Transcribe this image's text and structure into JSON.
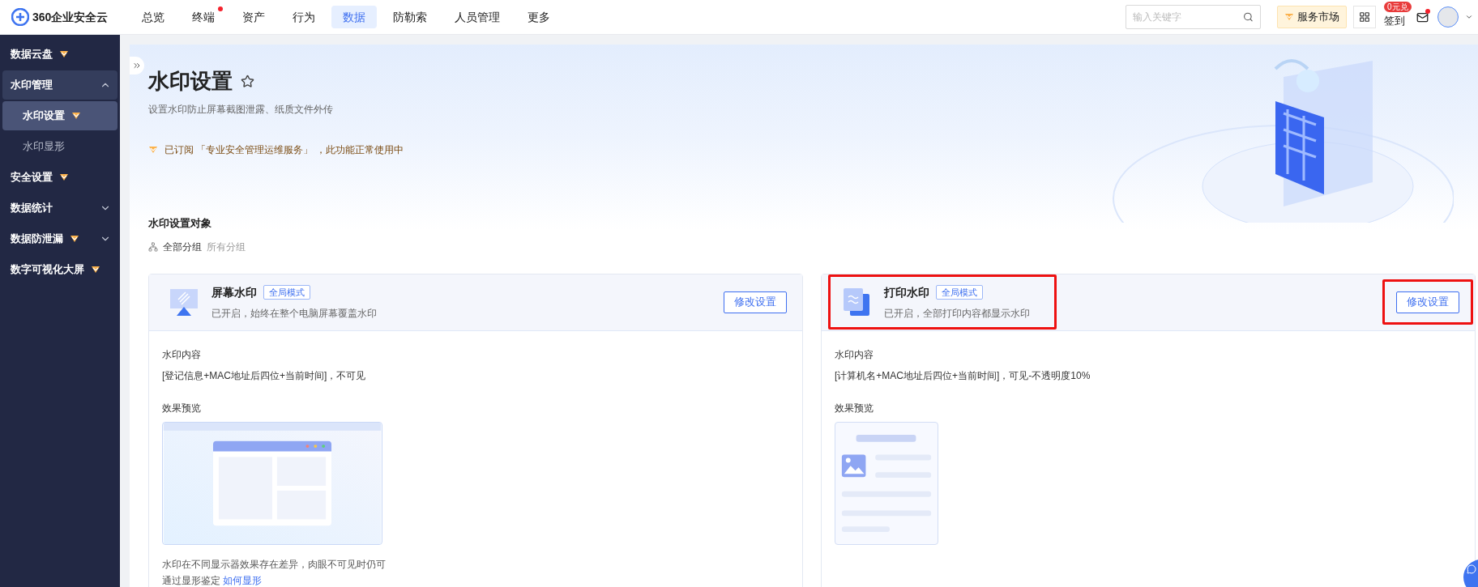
{
  "brand": "360企业安全云",
  "nav": [
    {
      "label": "总览",
      "selected": false,
      "alert": false
    },
    {
      "label": "终端",
      "selected": false,
      "alert": true
    },
    {
      "label": "资产",
      "selected": false,
      "alert": false
    },
    {
      "label": "行为",
      "selected": false,
      "alert": false
    },
    {
      "label": "数据",
      "selected": true,
      "alert": false
    },
    {
      "label": "防勒索",
      "selected": false,
      "alert": false
    },
    {
      "label": "人员管理",
      "selected": false,
      "alert": false
    },
    {
      "label": "更多",
      "selected": false,
      "alert": false
    }
  ],
  "search": {
    "placeholder": "输入关键字"
  },
  "service_market": "服务市场",
  "checkin": {
    "label": "签到",
    "badge": "0元兑"
  },
  "mail": {
    "unread": true
  },
  "sidebar": {
    "items": [
      {
        "label": "数据云盘",
        "premium": true,
        "selected": false
      },
      {
        "label": "水印管理",
        "premium": false,
        "selected": false,
        "expanded": true,
        "children": [
          {
            "label": "水印设置",
            "premium": true,
            "selected": true
          },
          {
            "label": "水印显形",
            "premium": false,
            "selected": false
          }
        ]
      },
      {
        "label": "安全设置",
        "premium": true,
        "selected": false
      },
      {
        "label": "数据统计",
        "premium": false,
        "selected": false,
        "expanded": false
      },
      {
        "label": "数据防泄漏",
        "premium": true,
        "selected": false,
        "expanded": false
      },
      {
        "label": "数字可视化大屏",
        "premium": true,
        "selected": false
      }
    ]
  },
  "page": {
    "title": "水印设置",
    "favorite": false,
    "subtitle": "设置水印防止屏幕截图泄露、纸质文件外传",
    "subscription": "已订阅 「专业安全管理运维服务」 ，此功能正常使用中"
  },
  "target": {
    "title": "水印设置对象",
    "group": "全部分组",
    "group_value": "所有分组"
  },
  "cards": [
    {
      "kind": "screen",
      "title": "屏幕水印",
      "tag": "全局模式",
      "status": "已开启，始终在整个电脑屏幕覆盖水印",
      "button": "修改设置",
      "header_highlighted": false,
      "button_highlighted": false,
      "content_label": "水印内容",
      "content": "[登记信息+MAC地址后四位+当前时间]，不可见",
      "preview_label": "效果预览",
      "note": "水印在不同显示器效果存在差异，肉眼不可见时仍可通过显形鉴定",
      "link": "如何显形"
    },
    {
      "kind": "print",
      "title": "打印水印",
      "tag": "全局模式",
      "status": "已开启，全部打印内容都显示水印",
      "button": "修改设置",
      "header_highlighted": true,
      "button_highlighted": true,
      "content_label": "水印内容",
      "content": "[计算机名+MAC地址后四位+当前时间]，可见-不透明度10%",
      "preview_label": "效果预览"
    }
  ]
}
